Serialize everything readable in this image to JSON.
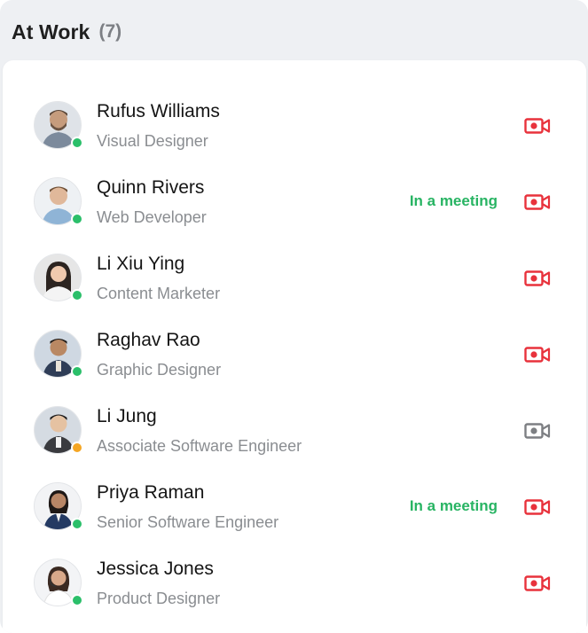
{
  "group": {
    "title": "At Work",
    "count": "(7)"
  },
  "colors": {
    "online": "#2bbf6a",
    "away": "#f5a623",
    "video_active": "#e8323c",
    "video_inactive": "#7d7f83",
    "status_text": "#28b463"
  },
  "contacts": [
    {
      "name": "Rufus Williams",
      "role": "Visual Designer",
      "status": "",
      "presence": "online",
      "video_icon": "video-camera-icon",
      "video_state": "active"
    },
    {
      "name": "Quinn Rivers",
      "role": "Web Developer",
      "status": "In a meeting",
      "presence": "online",
      "video_icon": "video-camera-icon",
      "video_state": "active"
    },
    {
      "name": "Li Xiu Ying",
      "role": "Content Marketer",
      "status": "",
      "presence": "online",
      "video_icon": "video-camera-icon",
      "video_state": "active"
    },
    {
      "name": "Raghav Rao",
      "role": "Graphic Designer",
      "status": "",
      "presence": "online",
      "video_icon": "video-camera-icon",
      "video_state": "active"
    },
    {
      "name": "Li Jung",
      "role": "Associate Software Engineer",
      "status": "",
      "presence": "away",
      "video_icon": "video-camera-icon",
      "video_state": "inactive"
    },
    {
      "name": "Priya Raman",
      "role": "Senior Software Engineer",
      "status": "In a meeting",
      "presence": "online",
      "video_icon": "video-camera-icon",
      "video_state": "active"
    },
    {
      "name": "Jessica Jones",
      "role": "Product Designer",
      "status": "",
      "presence": "online",
      "video_icon": "video-camera-icon",
      "video_state": "active"
    }
  ]
}
